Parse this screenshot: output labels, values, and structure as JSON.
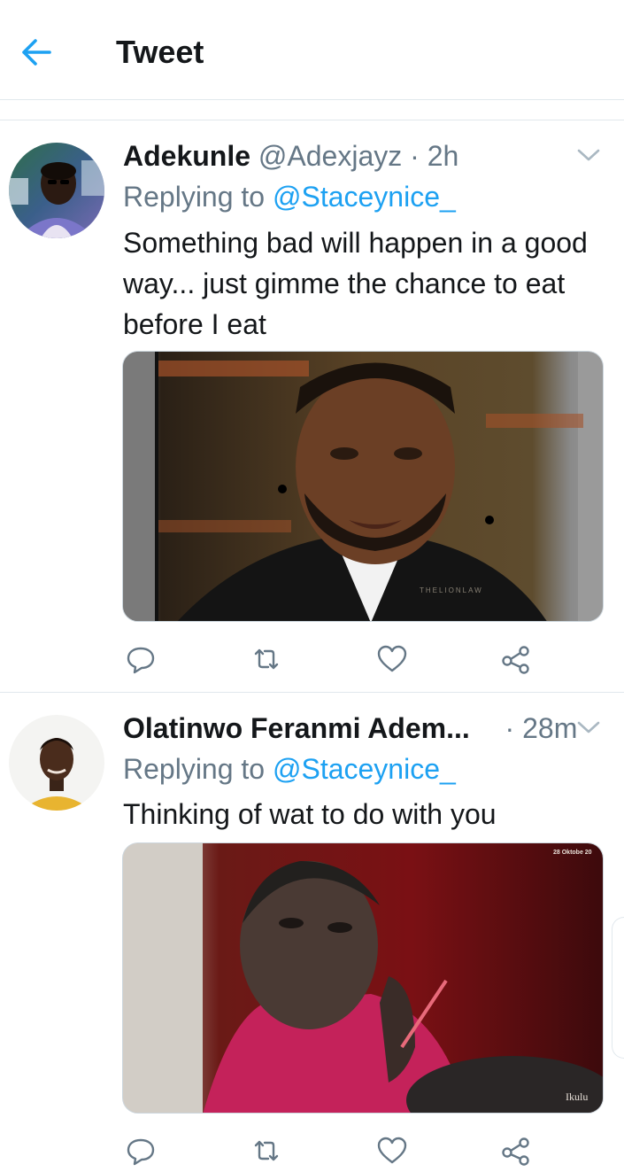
{
  "header": {
    "title": "Tweet",
    "back_icon": "arrow-left-icon",
    "accent": "#1da1f2"
  },
  "tweets": [
    {
      "display_name": "Adekunle",
      "handle": "@Adexjayz",
      "separator": "·",
      "time": "2h",
      "replying_prefix": "Replying to",
      "replying_to": "@Staceynice_",
      "text": "Something bad  will happen in a good way... just gimme the chance to eat before I eat",
      "media_watermark": "THELIONLAW"
    },
    {
      "display_name": "Olatinwo Feranmi Adem...",
      "separator": "·",
      "time": "28m",
      "replying_prefix": "Replying to",
      "replying_to": "@Staceynice_",
      "text": "Thinking of wat to do with you",
      "media_caption_top": "28 Oktobe 20",
      "media_watermark": "Ikulu"
    }
  ],
  "icons": {
    "reply": "reply-icon",
    "retweet": "retweet-icon",
    "like": "heart-icon",
    "share": "share-icon",
    "more": "chevron-down-icon"
  },
  "colors": {
    "text_primary": "#14171a",
    "text_secondary": "#657786",
    "link": "#1da1f2",
    "divider": "#e1e8ed"
  }
}
